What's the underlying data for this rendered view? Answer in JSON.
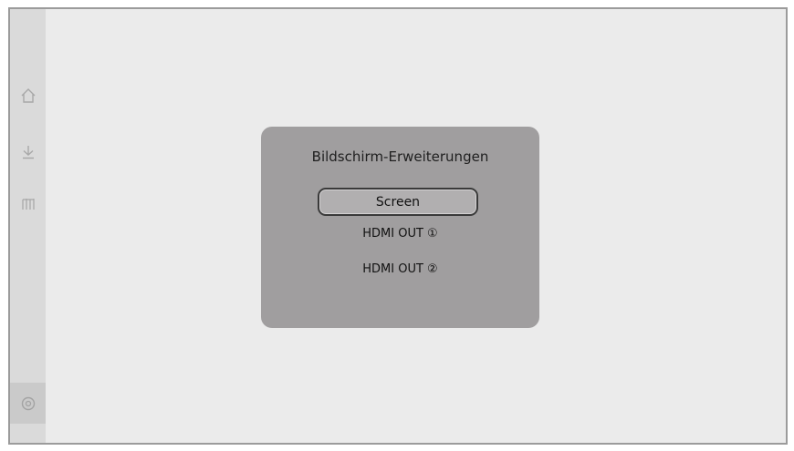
{
  "dialog": {
    "title": "Bildschirm-Erweiterungen",
    "options": [
      "Screen",
      "HDMI OUT ①",
      "HDMI OUT ②"
    ],
    "selected": "Screen"
  },
  "sidebar": {
    "icons": [
      "home-icon",
      "download-icon",
      "apps-icon",
      "settings-icon"
    ]
  },
  "colors": {
    "screen_bg": "#ebebeb",
    "sidebar_bg": "#dadada",
    "dialog_bg": "#a09e9f",
    "selected_border": "#3a3a3a"
  }
}
